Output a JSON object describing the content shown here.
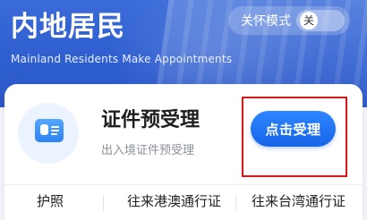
{
  "header": {
    "title": "内地居民",
    "subtitle": "Mainland Residents Make Appointments",
    "care_mode": {
      "label": "关怀模式",
      "switch_text": "关"
    }
  },
  "service": {
    "title": "证件预受理",
    "subtitle": "出入境证件预受理",
    "button_label": "点击受理"
  },
  "tabs": [
    {
      "label": "护照"
    },
    {
      "label": "往来港澳通行证"
    },
    {
      "label": "往来台湾通行证"
    }
  ],
  "colors": {
    "hero": "#2f5fd0",
    "accent": "#1664e8",
    "highlight": "#d41818"
  }
}
